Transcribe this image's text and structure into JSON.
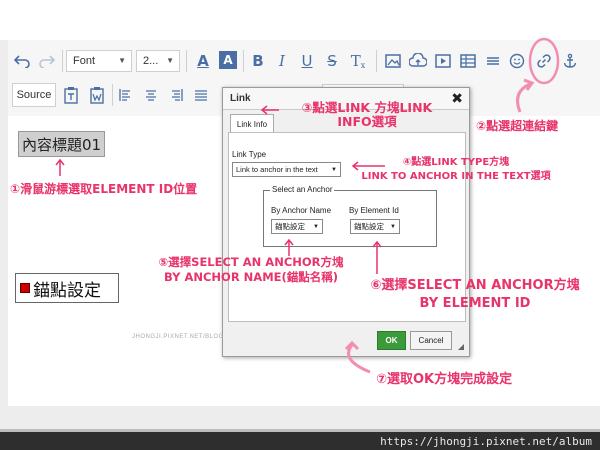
{
  "toolbar": {
    "row1": {
      "undo_icon": "undo-icon",
      "redo_icon": "redo-icon",
      "font_combo": "Font",
      "size_combo": "2...",
      "text_color_label": "A",
      "bg_color_label": "A",
      "bold": "B",
      "italic": "I",
      "underline": "U",
      "strike": "S",
      "clear_format": "T"
    },
    "row2": {
      "source_label": "Source"
    }
  },
  "content": {
    "heading": "內容標題01",
    "anchor_label": "錨點設定"
  },
  "dialog": {
    "title": "Link",
    "close": "✖",
    "tab_link_info": "Link Info",
    "link_type_label": "Link Type",
    "link_type_value": "Link to anchor in the text",
    "select_anchor_legend": "Select an Anchor",
    "by_anchor_name_label": "By Anchor Name",
    "by_element_id_label": "By Element Id",
    "anchor_name_value": "錨點設定",
    "element_id_value": "錨點設定",
    "watermark": "JHONGJI.PIXNET.NET/BLOG",
    "ok_label": "OK",
    "cancel_label": "Cancel"
  },
  "annotations": {
    "a1": "①滑鼠游標選取ELEMENT ID位置",
    "a2": "②點選超連結鍵",
    "a3_line1": "③點選LINK 方塊LINK",
    "a3_line2": "INFO選項",
    "a4_line1": "④點選LINK TYPE方塊",
    "a4_line2": "LINK TO ANCHOR IN THE TEXT選項",
    "a5_line1": "⑤選擇SELECT AN ANCHOR方塊",
    "a5_line2": "BY ANCHOR NAME(錨點名稱)",
    "a6_line1": "⑥選擇SELECT AN ANCHOR方塊",
    "a6_line2": "BY ELEMENT ID",
    "a7": "⑦選取OK方塊完成設定"
  },
  "footer": {
    "url": "https://jhongji.pixnet.net/album"
  },
  "colors": {
    "annotation": "#e8336b",
    "ok_button": "#3b9b3b",
    "toolbar_icon": "#4a6fa5"
  }
}
